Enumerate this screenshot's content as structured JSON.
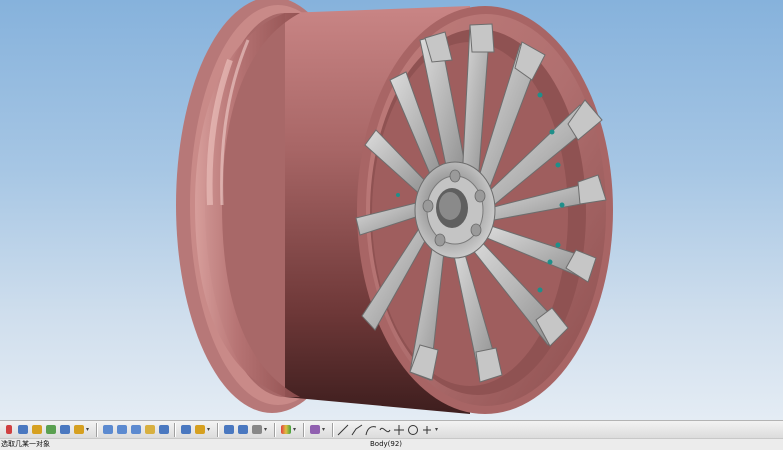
{
  "statusbar": {
    "prompt": "选取几某一对象",
    "selection": "Body(92)"
  },
  "viewport": {
    "model": "wheel-rim",
    "colors": {
      "rim_barrel": "#b06f6f",
      "rim_barrel_dark": "#4a2424",
      "rim_highlight": "#d9a3a0",
      "spokes": "#b9b9b9",
      "spokes_shadow": "#7a7a7a",
      "bolts": "#1f8f8a",
      "background_top": "#86b2dc",
      "background_bottom": "#e4ecf4"
    }
  },
  "toolbar": {
    "groups": [
      {
        "name": "snap-group",
        "icons": [
          "select-icon",
          "snap-point-icon",
          "snap-end-icon",
          "snap-mid-icon",
          "snap-center-icon",
          "snap-quad-icon"
        ]
      },
      {
        "name": "view-group",
        "icons": [
          "view-front-icon",
          "view-top-icon",
          "view-right-icon",
          "view-iso-icon",
          "view-rotate-icon"
        ]
      },
      {
        "name": "render-group",
        "icons": [
          "shaded-icon",
          "wireframe-icon",
          "hidden-line-icon"
        ]
      },
      {
        "name": "analysis-group",
        "icons": [
          "color-icon"
        ]
      },
      {
        "name": "layer-group",
        "icons": [
          "layer-icon"
        ]
      },
      {
        "name": "sketch-group",
        "icons": [
          "line-icon",
          "polyline-icon",
          "arc-icon",
          "spline-icon",
          "point-icon",
          "circle-icon",
          "plus-icon"
        ]
      }
    ]
  }
}
